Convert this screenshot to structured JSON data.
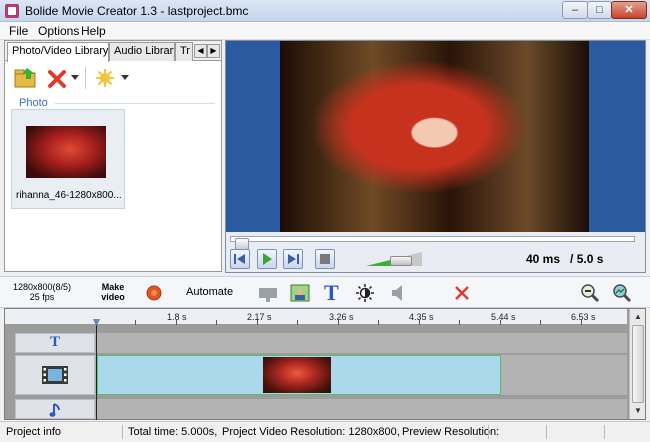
{
  "window": {
    "title": "Bolide Movie Creator 1.3 - lastproject.bmc"
  },
  "menu": [
    "File",
    "Options",
    "Help"
  ],
  "library": {
    "tabs": [
      "Photo/Video Library",
      "Audio Library",
      "Tr"
    ],
    "section_label": "Photo",
    "items": [
      {
        "name": "rihanna_46-1280x800..."
      }
    ]
  },
  "player": {
    "current_time": "40 ms",
    "total_time": "/ 5.0 s",
    "seek_fraction": 0.01,
    "volume_fraction": 0.7
  },
  "toolbar": {
    "video_info_line1": "1280x800(8/5)",
    "video_info_line2": "25 fps",
    "make_video_line1": "Make",
    "make_video_line2": "video",
    "automate_label": "Automate",
    "text_tool_glyph": "T"
  },
  "timeline": {
    "ruler_ticks": [
      "1.8 s",
      "2.17 s",
      "3.26 s",
      "4.35 s",
      "5.44 s",
      "6.53 s"
    ],
    "text_track_glyph": "T"
  },
  "status": {
    "project_info": "Project info",
    "total_time": "Total time: 5.000s,",
    "project_resolution": "Project Video Resolution:   1280x800,",
    "preview_resolution": "Preview Resolution:"
  },
  "colors": {
    "preview_background": "#2c5aa0",
    "clip_fill": "#a9d9ea",
    "clip_border": "#57c06f",
    "volume_fill": "#3fae35",
    "accent_blue": "#2b59c3",
    "delete_red": "#e23a2e",
    "record_orange": "#e0561f"
  },
  "icons": [
    "app-icon",
    "open-folder-icon",
    "delete-icon",
    "dropdown-arrow-icon",
    "effects-star-icon",
    "skip-back-icon",
    "play-icon",
    "skip-forward-icon",
    "stop-icon",
    "record-icon",
    "transition-icon",
    "image-icon",
    "text-icon",
    "brightness-icon",
    "audio-icon",
    "close-red-icon",
    "zoom-out-icon",
    "zoom-fit-icon",
    "music-note-icon",
    "film-strip-icon"
  ]
}
